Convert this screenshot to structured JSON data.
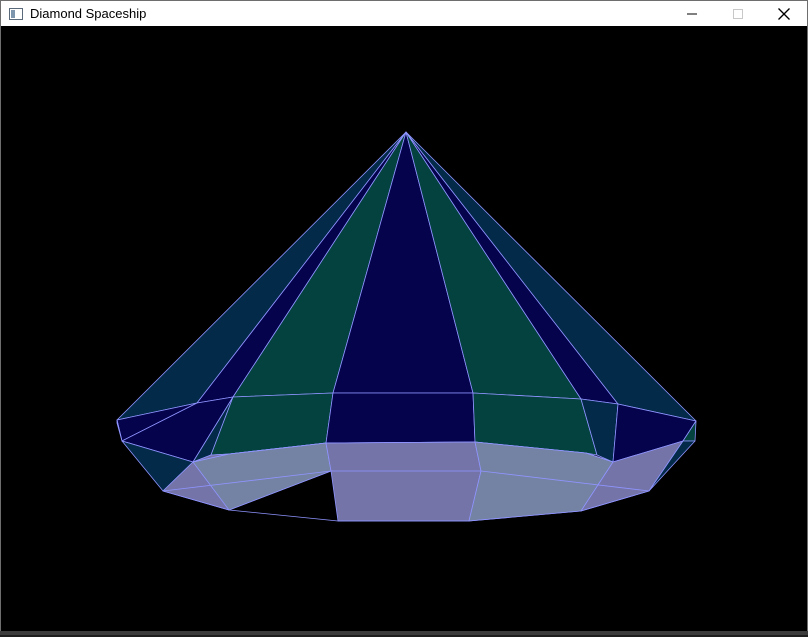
{
  "window": {
    "title": "Diamond Spaceship",
    "icon": "window-app-icon",
    "controls": {
      "minimize_icon": "minimize-icon",
      "maximize_icon": "maximize-icon",
      "close_icon": "close-icon"
    }
  },
  "scene": {
    "background": "#000000",
    "edge_color": "#8f94ff",
    "colors": {
      "navy": "#04034c",
      "teal": "#03423f",
      "blue": "#032a49",
      "lavender": "#7474a8",
      "slate": "#7483a3"
    }
  }
}
